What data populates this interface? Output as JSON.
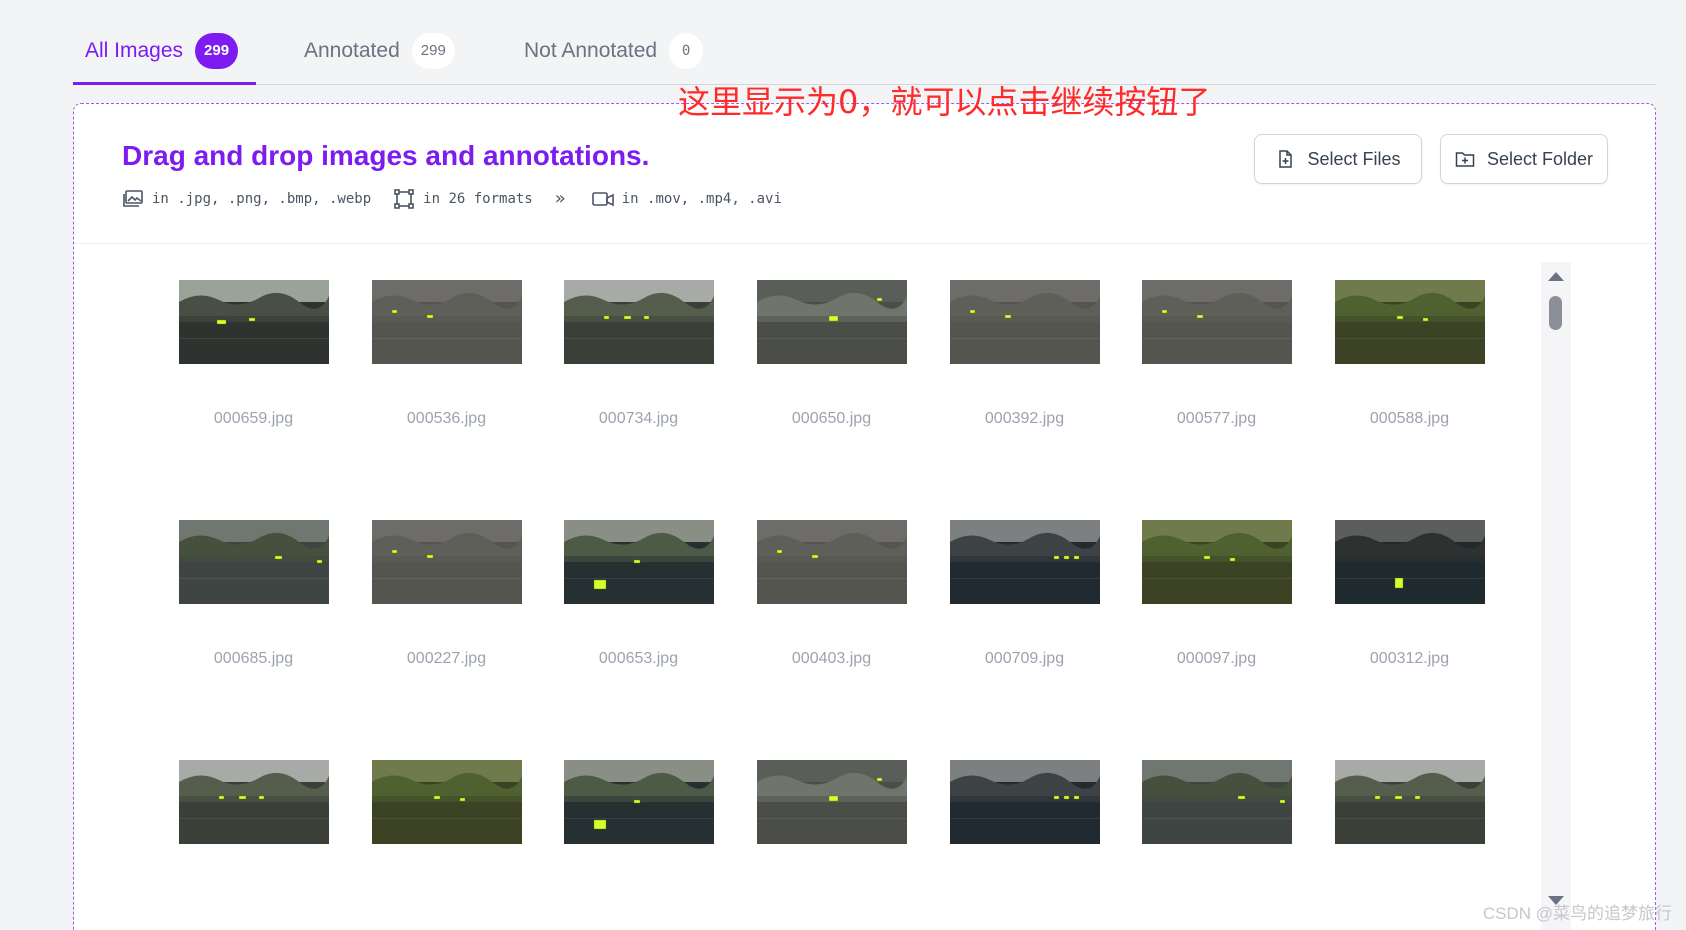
{
  "tabs": [
    {
      "label": "All Images",
      "count": "299",
      "active": true
    },
    {
      "label": "Annotated",
      "count": "299",
      "active": false
    },
    {
      "label": "Not Annotated",
      "count": "0",
      "active": false
    }
  ],
  "overlay_note": "这里显示为0，就可以点击继续按钮了",
  "dropzone": {
    "title": "Drag and drop images and annotations.",
    "formats": {
      "images": "in .jpg, .png, .bmp, .webp",
      "annotations": "in 26 formats",
      "more": "»",
      "videos": "in .mov, .mp4, .avi"
    },
    "select_files": "Select Files",
    "select_folder": "Select Folder"
  },
  "images": [
    {
      "name": "000659.jpg",
      "scene": "shore"
    },
    {
      "name": "000536.jpg",
      "scene": "wall"
    },
    {
      "name": "000734.jpg",
      "scene": "city"
    },
    {
      "name": "000650.jpg",
      "scene": "bridge"
    },
    {
      "name": "000392.jpg",
      "scene": "wall"
    },
    {
      "name": "000577.jpg",
      "scene": "wall"
    },
    {
      "name": "000588.jpg",
      "scene": "willow"
    },
    {
      "name": "000685.jpg",
      "scene": "trees"
    },
    {
      "name": "000227.jpg",
      "scene": "wall"
    },
    {
      "name": "000653.jpg",
      "scene": "park"
    },
    {
      "name": "000403.jpg",
      "scene": "wall"
    },
    {
      "name": "000709.jpg",
      "scene": "boat"
    },
    {
      "name": "000097.jpg",
      "scene": "willow"
    },
    {
      "name": "000312.jpg",
      "scene": "dark"
    },
    {
      "name": "",
      "scene": "city"
    },
    {
      "name": "",
      "scene": "willow"
    },
    {
      "name": "",
      "scene": "park"
    },
    {
      "name": "",
      "scene": "bridge"
    },
    {
      "name": "",
      "scene": "boat"
    },
    {
      "name": "",
      "scene": "trees"
    },
    {
      "name": "",
      "scene": "city"
    }
  ],
  "watermark": "CSDN @菜鸟的追梦旅行",
  "colors": {
    "accent": "#7c1cf0",
    "annotation_note": "#ff2a2a",
    "bbox": "#d9ff2a"
  }
}
